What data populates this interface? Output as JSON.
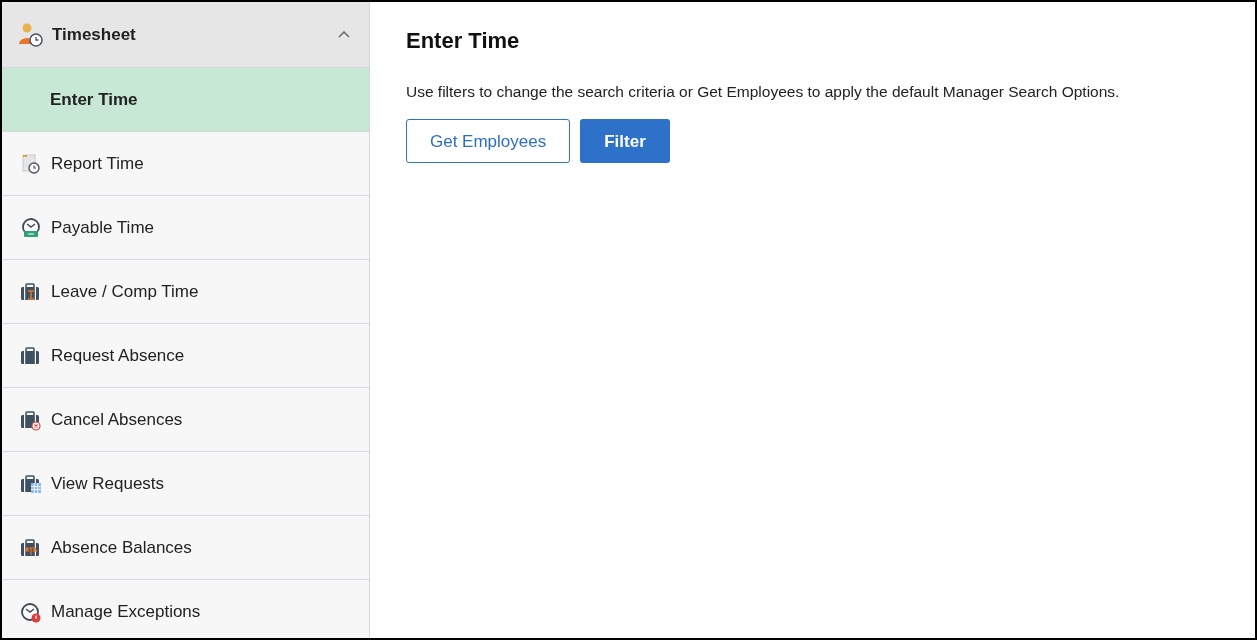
{
  "sidebar": {
    "header": {
      "label": "Timesheet",
      "expanded": true
    },
    "items": [
      {
        "label": "Enter Time",
        "kind": "sub",
        "selected": true
      },
      {
        "label": "Report Time",
        "kind": "report",
        "selected": false
      },
      {
        "label": "Payable Time",
        "kind": "payable",
        "selected": false
      },
      {
        "label": "Leave / Comp Time",
        "kind": "leave",
        "selected": false
      },
      {
        "label": "Request Absence",
        "kind": "request",
        "selected": false
      },
      {
        "label": "Cancel Absences",
        "kind": "cancel",
        "selected": false
      },
      {
        "label": "View Requests",
        "kind": "view",
        "selected": false
      },
      {
        "label": "Absence Balances",
        "kind": "balances",
        "selected": false
      },
      {
        "label": "Manage Exceptions",
        "kind": "exceptions",
        "selected": false
      }
    ]
  },
  "main": {
    "title": "Enter Time",
    "description": "Use filters to change the search criteria or Get Employees to apply the default Manager Search Options.",
    "buttons": [
      {
        "label": "Get Employees",
        "kind": "secondary"
      },
      {
        "label": "Filter",
        "kind": "primary"
      }
    ]
  }
}
